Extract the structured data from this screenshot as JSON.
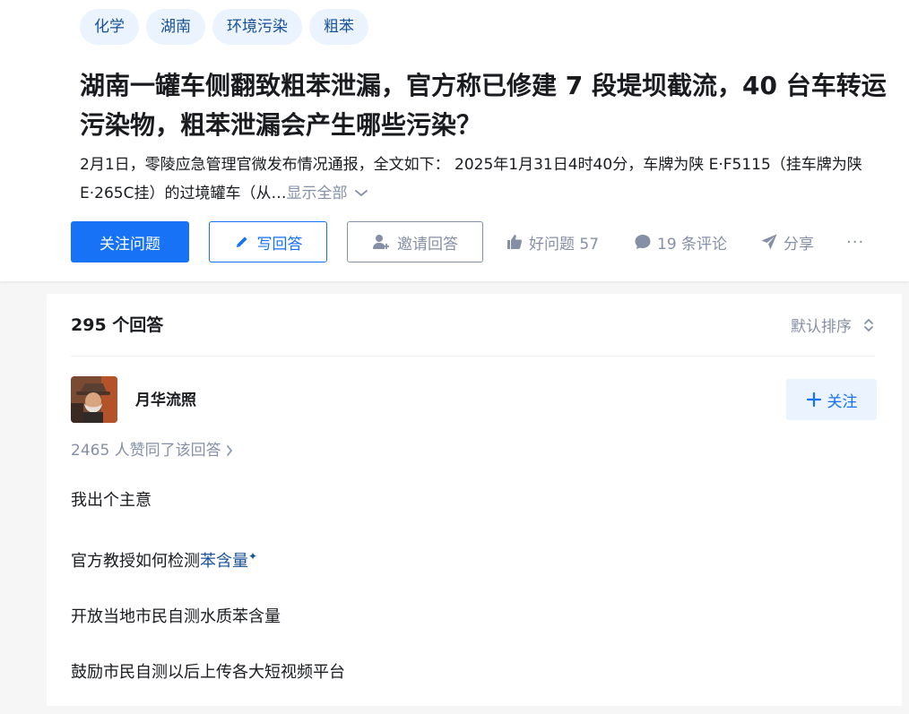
{
  "question": {
    "tags": [
      "化学",
      "湖南",
      "环境污染",
      "粗苯"
    ],
    "title": "湖南一罐车侧翻致粗苯泄漏，官方称已修建 7 段堤坝截流，40 台车转运污染物，粗苯泄漏会产生哪些污染？",
    "excerpt": "2月1日，零陵应急管理官微发布情况通报，全文如下： 2025年1月31日4时40分，车牌为陕 E·F5115（挂车牌为陕E·265C挂）的过境罐车（从…",
    "show_all": "显示全部"
  },
  "actions": {
    "follow_question": "关注问题",
    "write_answer": "写回答",
    "invite_answer": "邀请回答",
    "good_question": "好问题 57",
    "comments": "19 条评论",
    "share": "分享",
    "more": "···"
  },
  "answers": {
    "count_label": "295 个回答",
    "sort_label": "默认排序"
  },
  "answer": {
    "author": "月华流照",
    "follow_label": "关注",
    "votes_text": "2465 人赞同了该回答",
    "paragraphs": [
      {
        "text": "我出个主意"
      },
      {
        "prefix": "官方教授如何检测",
        "keyword": "苯含量",
        "mark": "✦"
      },
      {
        "text": "开放当地市民自测水质苯含量"
      },
      {
        "text": "鼓励市民自测以后上传各大短视频平台"
      }
    ]
  },
  "colors": {
    "brand": "#1772f6",
    "tag_bg": "#ebf3fe",
    "tag_text": "#175199",
    "muted": "#8590a6"
  }
}
